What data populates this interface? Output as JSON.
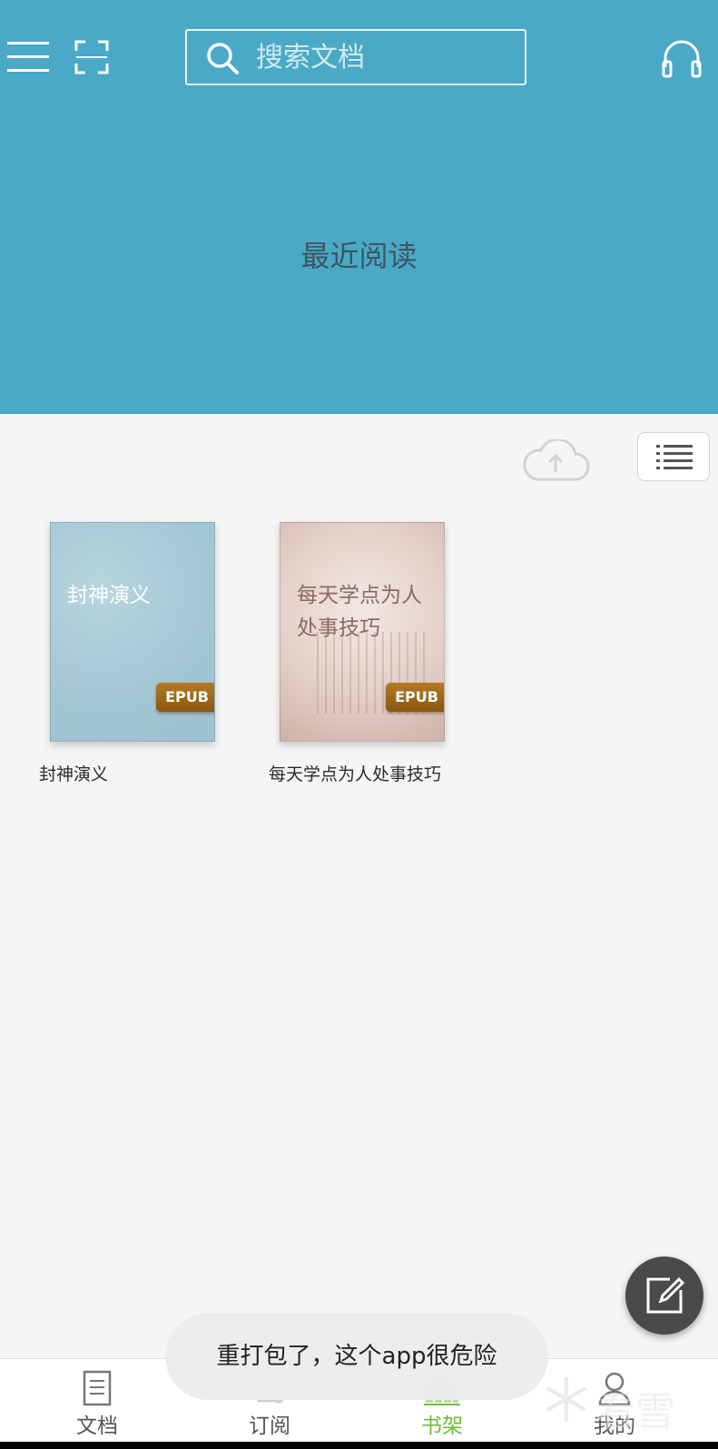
{
  "header": {
    "search_placeholder": "搜索文档",
    "recent_title": "最近阅读",
    "background_color": "#4aa9c7",
    "icons": [
      "menu-icon",
      "scan-icon",
      "search-icon",
      "headphone-icon"
    ]
  },
  "shelf": {
    "toolbar_icons": [
      "cloud-upload-icon",
      "list-view-icon"
    ],
    "books": [
      {
        "cover_title": "封神演义",
        "badge": "EPUB",
        "label": "封神演义"
      },
      {
        "cover_title": "每天学点为人处事技巧",
        "badge": "EPUB",
        "label": "每天学点为人处事技巧"
      }
    ]
  },
  "fab": {
    "icon": "edit-icon"
  },
  "toast": {
    "text": "重打包了，这个app很危险"
  },
  "bottom_nav": {
    "items": [
      {
        "label": "文档",
        "icon": "document-icon"
      },
      {
        "label": "订阅",
        "icon": "subscribe-icon"
      },
      {
        "label": "书架",
        "icon": "bookshelf-icon",
        "active": true
      },
      {
        "label": "我的",
        "icon": "profile-icon"
      }
    ],
    "active_color": "#6cbf3a"
  },
  "watermark": {
    "text": "看雪"
  }
}
